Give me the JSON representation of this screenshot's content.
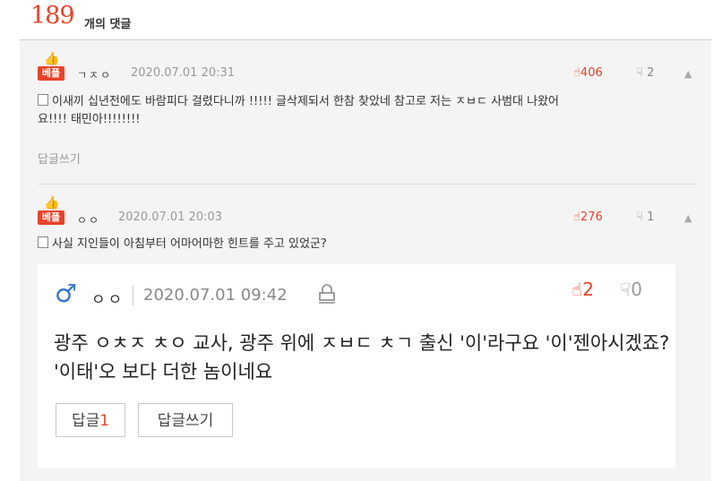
{
  "header": {
    "count": "189",
    "count_label": "개의 댓글"
  },
  "comments": [
    {
      "badge": "베플",
      "author": "ㄱㅈㅇ",
      "date": "2020.07.01 20:31",
      "likes": "406",
      "dislikes": "2",
      "text_line1": "이새끼 십년전에도 바람피다 걸렸다니까 !!!!! 글삭제되서 한참 찾았네 참고로 저는 ㅈㅂㄷ 사범대 나왔어",
      "text_line2": "요!!!! 태민아!!!!!!!!",
      "reply_label": "답글쓰기"
    },
    {
      "badge": "베플",
      "author": "ㅇㅇ",
      "date": "2020.07.01 20:03",
      "likes": "276",
      "dislikes": "1",
      "text_line1": "사실 지인들이 아침부터 어마어마한 힌트를 주고 있었군?"
    }
  ],
  "reply": {
    "gender_icon": "♂",
    "author": "ㅇㅇ",
    "date": "2020.07.01 09:42",
    "likes": "2",
    "dislikes": "0",
    "text": "광주 ㅇㅊㅈ ㅊㅇ 교사, 광주 위에 ㅈㅂㄷ ㅊㄱ 출신 '이'라구요 '이'젠아시겠죠? '이태'오 보다 더한 놈이네요",
    "reply_count_label": "답글",
    "reply_count": "1",
    "write_reply_label": "답글쓰기"
  },
  "colors": {
    "accent": "#e8432a",
    "male": "#3a78c9"
  }
}
